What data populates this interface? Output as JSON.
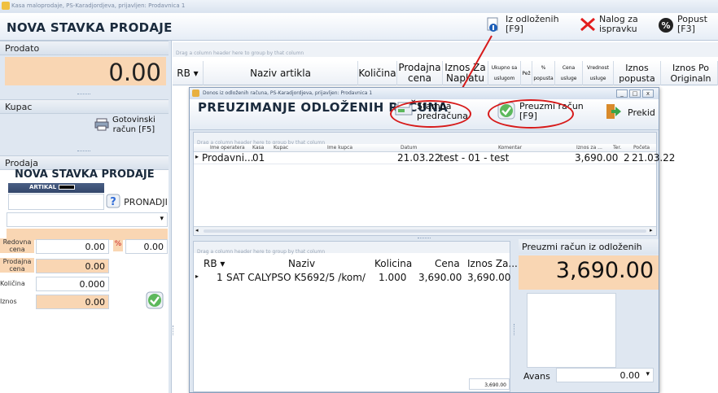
{
  "window_title": "Kasa maloprodaje, PS-Karadjordjeva, prijavljen: Prodavnica 1",
  "header": {
    "title": "NOVA STAVKA PRODAJE",
    "iz_odlozenih": "Iz odloženih",
    "iz_odlozenih_key": "[F9]",
    "nalog_label": "Nalog za",
    "nalog_label2": "ispravku",
    "popust_label": "Popust",
    "popust_key": "[F3]"
  },
  "left": {
    "prodato_label": "Prodato",
    "prodato_value": "0.00",
    "kupac_label": "Kupac",
    "gotovinski_label": "Gotovinski",
    "gotovinski_label2": "račun [F5]",
    "prodaja_label": "Prodaja",
    "nova_stavka": "NOVA STAVKA PRODAJE",
    "artikal_label": "ARTIKAL",
    "pronadji": "PRONADJI",
    "redovna_label": "Redovna",
    "redovna_label2": "cena",
    "redovna_value": "0.00",
    "pct_symbol": "%",
    "pct_value": "0.00",
    "prodajna_label": "Prodajna",
    "prodajna_label2": "cena",
    "prodajna_value": "0.00",
    "kolicina_label": "Količina",
    "kolicina_value": "0.000",
    "iznos_label": "Iznos",
    "iznos_value": "0.00"
  },
  "main_grid": {
    "group_hint": "Drag a column header here to group by that column",
    "columns": [
      "RB",
      "Naziv artikla",
      "Količina",
      "Prodajna cena",
      "Iznos Za Naplatu",
      "Ukupno sa uslugom",
      "Pež",
      "% popusta",
      "Cena usluge",
      "Vrednost usluge",
      "Iznos popusta",
      "Iznos Po Originaln"
    ]
  },
  "dialog": {
    "title": "Donos iz odloženih računa, PS-Karadjordjeva, prijavljen: Prodavnica 1",
    "heading": "PREUZIMANJE ODLOŽENIH RAČUNA",
    "stampa_label": "Štampa",
    "stampa_label2": "predračuna",
    "preuzmi_label": "Preuzmi račun",
    "preuzmi_key": "[F9]",
    "prekid_label": "Prekid",
    "top_grid": {
      "group_hint": "Drag a column header here to group by that column",
      "columns": [
        "Ime operatera",
        "Kasa",
        "Kupac",
        "Ime kupca",
        "Datum",
        "Komentar",
        "Iznos za ...",
        "Ter.",
        "Početa"
      ],
      "row": [
        "Prodavni...",
        "01",
        "",
        "",
        "21.03.22",
        "test - 01 - test",
        "3,690.00",
        "2",
        "21.03.22"
      ]
    },
    "bottom_grid": {
      "group_hint": "Drag a column header here to group by that column",
      "columns": [
        "RB",
        "Naziv",
        "Kolicina",
        "Cena",
        "Iznos Za..."
      ],
      "row": [
        "1",
        "SAT CALYPSO K5692/5 /kom/",
        "1.000",
        "3,690.00",
        "3,690.00"
      ],
      "footer_total": "3,690.00"
    },
    "summary": {
      "label": "Preuzmi račun iz odloženih",
      "amount": "3,690.00",
      "avans_label": "Avans",
      "avans_value": "0.00"
    }
  },
  "colors": {
    "peach": "#f9d6b3",
    "annotation_red": "#d71a1a",
    "panel_bg": "#dfe7f1"
  }
}
